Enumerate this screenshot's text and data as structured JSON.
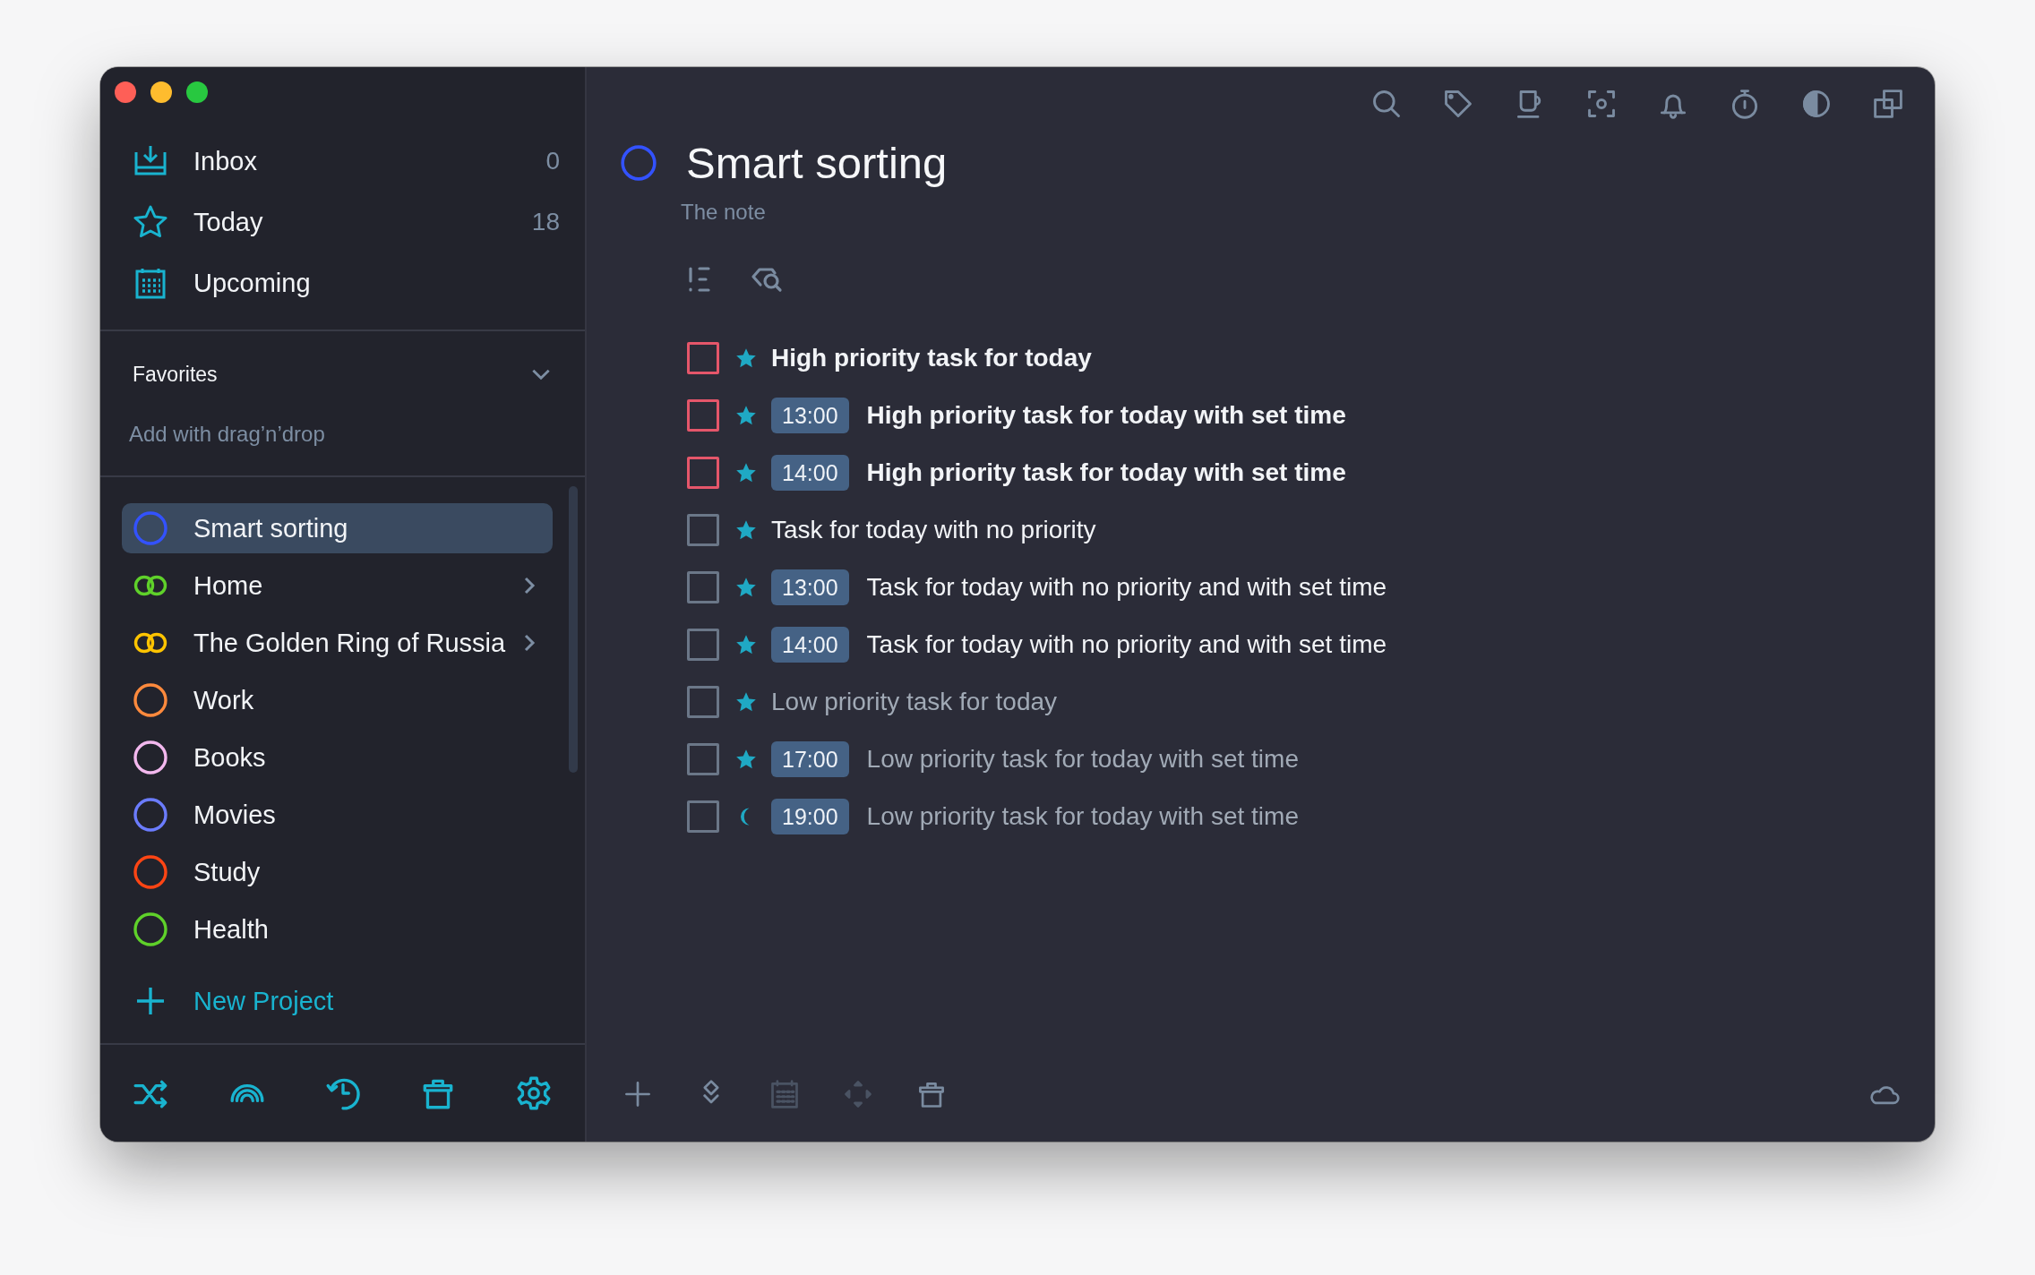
{
  "sidebar": {
    "nav": [
      {
        "kind": "inbox",
        "label": "Inbox",
        "count": "0"
      },
      {
        "kind": "today",
        "label": "Today",
        "count": "18"
      },
      {
        "kind": "upcoming",
        "label": "Upcoming"
      }
    ],
    "favorites": {
      "title": "Favorites",
      "expanded": true,
      "hint": "Add with drag’n’drop"
    },
    "projects": [
      {
        "kind": "project",
        "label": "Smart sorting",
        "color": "#3352ff",
        "selected": true
      },
      {
        "kind": "folder",
        "label": "Home",
        "color": "#5fd12a",
        "selected": false
      },
      {
        "kind": "folder",
        "label": "The Golden Ring of Russia",
        "color": "#ffc400",
        "selected": false
      },
      {
        "kind": "project",
        "label": "Work",
        "color": "#ff8a3d",
        "selected": false
      },
      {
        "kind": "project",
        "label": "Books",
        "color": "#f3b8ee",
        "selected": false
      },
      {
        "kind": "project",
        "label": "Movies",
        "color": "#6b7cff",
        "selected": false
      },
      {
        "kind": "project",
        "label": "Study",
        "color": "#ff4514",
        "selected": false
      },
      {
        "kind": "project",
        "label": "Health",
        "color": "#5fd12a",
        "selected": false
      }
    ],
    "new_project": "New Project",
    "bottom_toolbar": [
      {
        "kind": "shuffle"
      },
      {
        "kind": "rainbow"
      },
      {
        "kind": "history"
      },
      {
        "kind": "trash"
      },
      {
        "kind": "settings"
      }
    ]
  },
  "header_toolbar": [
    {
      "kind": "search"
    },
    {
      "kind": "tag"
    },
    {
      "kind": "cup"
    },
    {
      "kind": "focus"
    },
    {
      "kind": "bell"
    },
    {
      "kind": "timer"
    },
    {
      "kind": "contrast"
    },
    {
      "kind": "copy"
    }
  ],
  "project": {
    "title": "Smart sorting",
    "color": "#3352ff",
    "note": "The note"
  },
  "tasks": [
    {
      "title": "High priority task for today",
      "kind": "high",
      "evening": false,
      "checked": false
    },
    {
      "title": "High priority task for today with set time",
      "kind": "high",
      "evening": false,
      "time": "13:00",
      "checked": false
    },
    {
      "title": "High priority task for today with set time",
      "kind": "high",
      "evening": false,
      "time": "14:00",
      "checked": false
    },
    {
      "title": "Task for today with no priority",
      "kind": "normal",
      "evening": false,
      "checked": false
    },
    {
      "title": "Task for today with no priority and with set time",
      "kind": "normal",
      "evening": false,
      "time": "13:00",
      "checked": false
    },
    {
      "title": "Task for today with no priority and with set time",
      "kind": "normal",
      "evening": false,
      "time": "14:00",
      "checked": false
    },
    {
      "title": "Low priority task for today",
      "kind": "low",
      "evening": false,
      "checked": false
    },
    {
      "title": "Low priority task for today with set time",
      "kind": "low",
      "evening": false,
      "time": "17:00",
      "checked": false
    },
    {
      "title": "Low priority task for today with set time",
      "kind": "low",
      "evening": true,
      "time": "19:00",
      "checked": false
    }
  ],
  "bottom_toolbar": [
    {
      "kind": "add",
      "disabled": false
    },
    {
      "kind": "layers",
      "disabled": false
    },
    {
      "kind": "calendar",
      "disabled": true
    },
    {
      "kind": "move",
      "disabled": true
    },
    {
      "kind": "trash",
      "disabled": false
    }
  ],
  "sync": {
    "kind": "cloud"
  }
}
